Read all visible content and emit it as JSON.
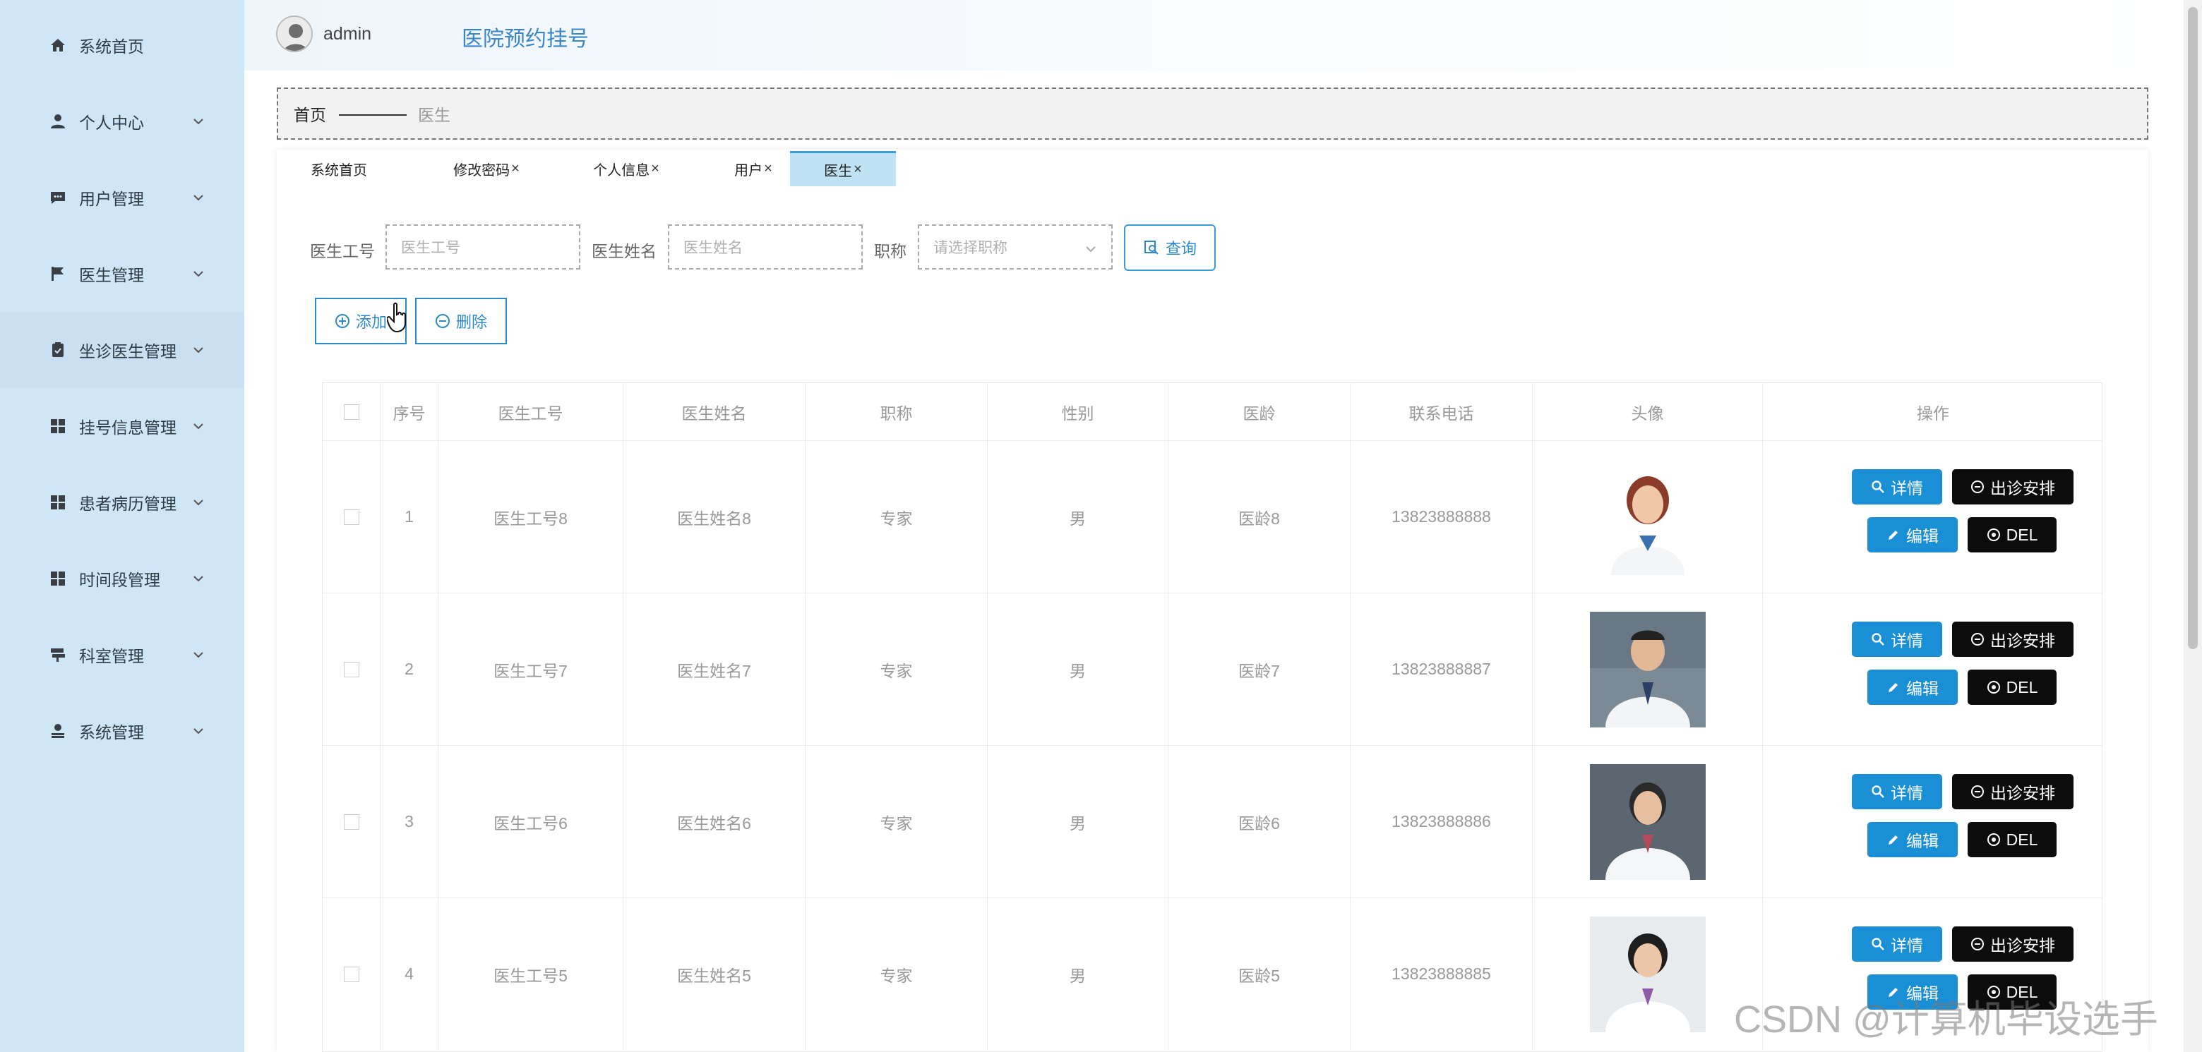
{
  "header": {
    "username": "admin",
    "app_title": "医院预约挂号"
  },
  "sidebar": {
    "items": [
      {
        "label": "系统首页",
        "icon": "home-icon"
      },
      {
        "label": "个人中心",
        "icon": "user-icon"
      },
      {
        "label": "用户管理",
        "icon": "chat-icon"
      },
      {
        "label": "医生管理",
        "icon": "flag-icon"
      },
      {
        "label": "坐诊医生管理",
        "icon": "clipboard-check-icon"
      },
      {
        "label": "挂号信息管理",
        "icon": "grid-icon"
      },
      {
        "label": "患者病历管理",
        "icon": "grid-icon"
      },
      {
        "label": "时间段管理",
        "icon": "grid-icon"
      },
      {
        "label": "科室管理",
        "icon": "signpost-icon"
      },
      {
        "label": "系统管理",
        "icon": "admin-user-icon"
      }
    ]
  },
  "breadcrumb": {
    "home": "首页",
    "current": "医生"
  },
  "tabs": [
    {
      "label": "系统首页",
      "close": ""
    },
    {
      "label": "修改密码",
      "close": "×"
    },
    {
      "label": "个人信息",
      "close": "×"
    },
    {
      "label": "用户",
      "close": "×"
    },
    {
      "label": "医生",
      "close": "×"
    }
  ],
  "search": {
    "id_label": "医生工号",
    "id_placeholder": "医生工号",
    "name_label": "医生姓名",
    "name_placeholder": "医生姓名",
    "title_label": "职称",
    "title_placeholder": "请选择职称",
    "query_label": "查询"
  },
  "actions": {
    "add_label": "添加",
    "delete_label": "删除"
  },
  "table": {
    "headers": [
      "序号",
      "医生工号",
      "医生姓名",
      "职称",
      "性别",
      "医龄",
      "联系电话",
      "头像",
      "操作"
    ],
    "rows": [
      {
        "index": "1",
        "doctor_id": "医生工号8",
        "doctor_name": "医生姓名8",
        "title": "专家",
        "gender": "男",
        "years": "医龄8",
        "phone": "13823888888"
      },
      {
        "index": "2",
        "doctor_id": "医生工号7",
        "doctor_name": "医生姓名7",
        "title": "专家",
        "gender": "男",
        "years": "医龄7",
        "phone": "13823888887"
      },
      {
        "index": "3",
        "doctor_id": "医生工号6",
        "doctor_name": "医生姓名6",
        "title": "专家",
        "gender": "男",
        "years": "医龄6",
        "phone": "13823888886"
      },
      {
        "index": "4",
        "doctor_id": "医生工号5",
        "doctor_name": "医生姓名5",
        "title": "专家",
        "gender": "男",
        "years": "医龄5",
        "phone": "13823888885"
      }
    ],
    "ops": {
      "detail": "详情",
      "schedule": "出诊安排",
      "edit": "编辑",
      "del": "DEL"
    }
  },
  "watermark": "CSDN @计算机毕设选手",
  "colors": {
    "sidebar_bg": "#cfe6f6",
    "accent": "#1a8fd5",
    "dark_button": "#0c0c0c",
    "title_blue": "#3a86c8"
  }
}
